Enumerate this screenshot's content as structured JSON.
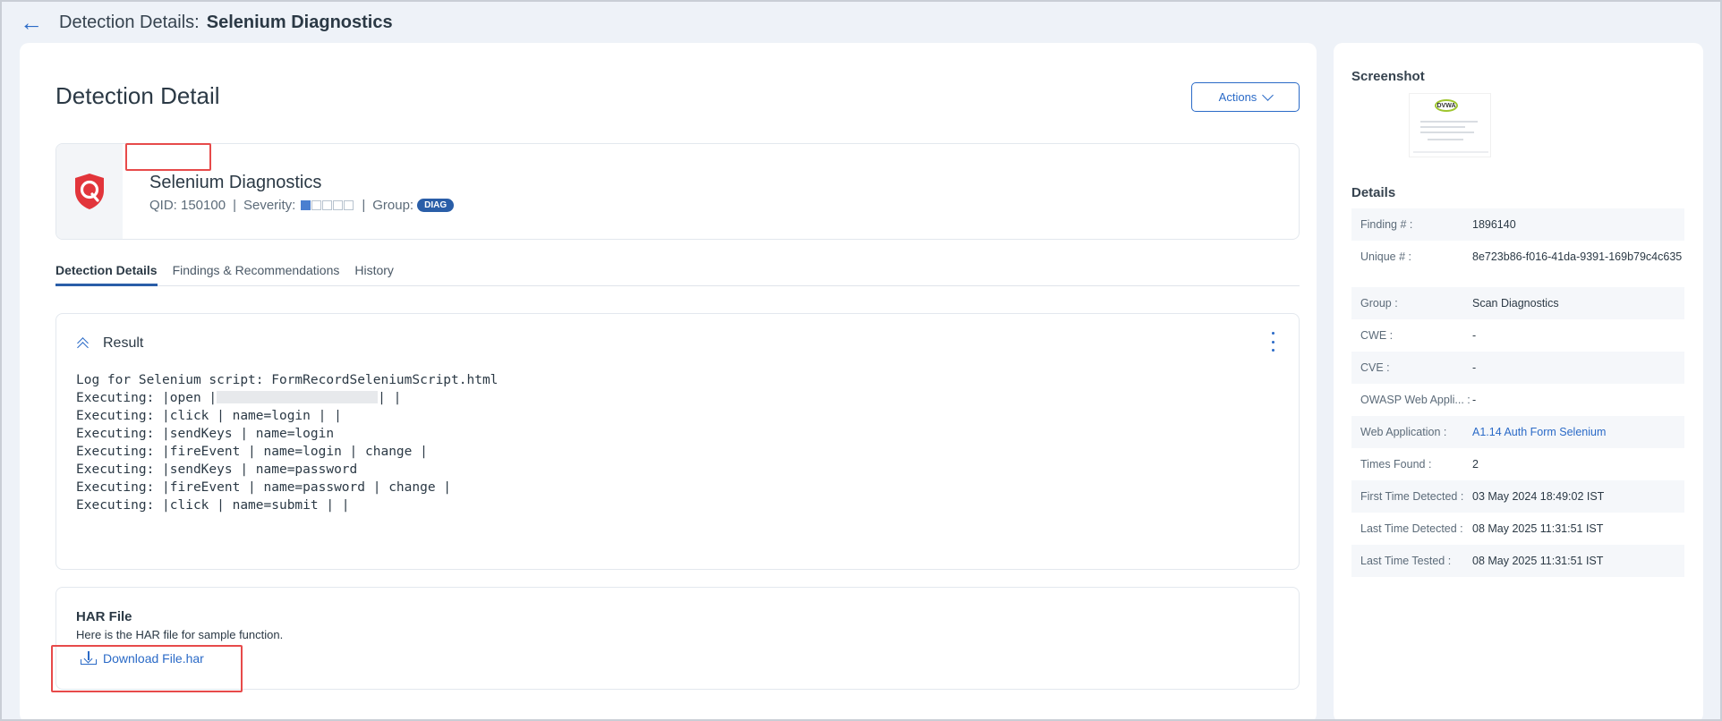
{
  "header": {
    "back_icon": "arrow-left-icon",
    "prefix": "Detection Details:",
    "name": "Selenium Diagnostics"
  },
  "main": {
    "title": "Detection Detail",
    "actions_label": "Actions",
    "qid_card": {
      "logo_icon": "qualys-shield-icon",
      "name": "Selenium Diagnostics",
      "qid": "QID: 150100",
      "severity_label": "Severity:",
      "severity_level": 1,
      "severity_max": 5,
      "separator": "|",
      "group_label": "Group:",
      "group_badge": "DIAG"
    },
    "tabs": [
      {
        "label": "Detection Details",
        "active": true
      },
      {
        "label": "Findings & Recommendations",
        "active": false
      },
      {
        "label": "History",
        "active": false
      }
    ],
    "result": {
      "title": "Result",
      "log": [
        "Log for Selenium script: FormRecordSeleniumScript.html",
        "Executing: |open |",
        "Executing: |click | name=login | |",
        "Executing: |sendKeys | name=login",
        "Executing: |fireEvent | name=login | change |",
        "Executing: |sendKeys | name=password",
        "Executing: |fireEvent | name=password | change |",
        "Executing: |click | name=submit | |"
      ],
      "redacted_suffix": "| |"
    },
    "har": {
      "title": "HAR File",
      "description": "Here is the HAR file for sample function.",
      "link": "Download File.har"
    }
  },
  "side": {
    "screenshot_heading": "Screenshot",
    "thumbnail_text": "DVWA",
    "details_heading": "Details",
    "details": [
      {
        "label": "Finding #",
        "value": "1896140"
      },
      {
        "label": "Unique #",
        "value": "8e723b86-f016-41da-9391-169b79c4c635"
      },
      {
        "label": "Group",
        "value": "Scan Diagnostics"
      },
      {
        "label": "CWE",
        "value": "-"
      },
      {
        "label": "CVE",
        "value": "-"
      },
      {
        "label": "OWASP Web Appli...",
        "value": "-"
      },
      {
        "label": "Web Application",
        "value": "A1.14 Auth Form Selenium",
        "link": true
      },
      {
        "label": "Times Found",
        "value": "2"
      },
      {
        "label": "First Time Detected",
        "value": "03 May 2024 18:49:02 IST"
      },
      {
        "label": "Last Time Detected",
        "value": "08 May 2025 11:31:51 IST"
      },
      {
        "label": "Last Time Tested",
        "value": "08 May 2025 11:31:51 IST"
      }
    ]
  },
  "colors": {
    "accent": "#2a6ac7",
    "badge": "#2a5ea8",
    "highlight": "#e74a4a",
    "background": "#eef2f8"
  }
}
